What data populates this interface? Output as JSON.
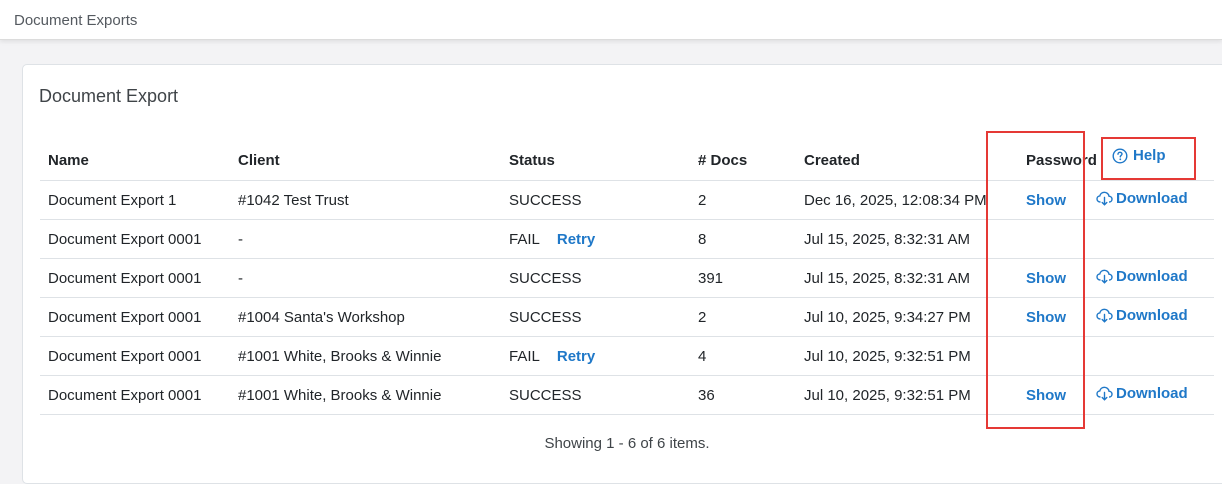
{
  "header": {
    "breadcrumb": "Document Exports"
  },
  "card": {
    "title": "Document Export"
  },
  "table": {
    "columns": {
      "name": "Name",
      "client": "Client",
      "status": "Status",
      "docs": "# Docs",
      "created": "Created",
      "password": "Password",
      "help": "Help"
    },
    "rows": [
      {
        "name": "Document Export 1",
        "client": "#1042 Test Trust",
        "status": "SUCCESS",
        "retry": "",
        "docs": "2",
        "created": "Dec 16, 2025, 12:08:34 PM",
        "password": "Show",
        "download": "Download"
      },
      {
        "name": "Document Export 0001",
        "client": "-",
        "status": "FAIL",
        "retry": "Retry",
        "docs": "8",
        "created": "Jul 15, 2025, 8:32:31 AM",
        "password": "",
        "download": ""
      },
      {
        "name": "Document Export 0001",
        "client": "-",
        "status": "SUCCESS",
        "retry": "",
        "docs": "391",
        "created": "Jul 15, 2025, 8:32:31 AM",
        "password": "Show",
        "download": "Download"
      },
      {
        "name": "Document Export 0001",
        "client": "#1004 Santa's Workshop",
        "status": "SUCCESS",
        "retry": "",
        "docs": "2",
        "created": "Jul 10, 2025, 9:34:27 PM",
        "password": "Show",
        "download": "Download"
      },
      {
        "name": "Document Export 0001",
        "client": "#1001 White, Brooks & Winnie",
        "status": "FAIL",
        "retry": "Retry",
        "docs": "4",
        "created": "Jul 10, 2025, 9:32:51 PM",
        "password": "",
        "download": ""
      },
      {
        "name": "Document Export 0001",
        "client": "#1001 White, Brooks & Winnie",
        "status": "SUCCESS",
        "retry": "",
        "docs": "36",
        "created": "Jul 10, 2025, 9:32:51 PM",
        "password": "Show",
        "download": "Download"
      }
    ]
  },
  "pagination": {
    "summary": "Showing 1 - 6 of 6 items."
  },
  "icons": {
    "help": "question-circle-icon",
    "download": "cloud-download-icon"
  },
  "colors": {
    "link": "#1f78c8",
    "highlight": "#e53935"
  }
}
